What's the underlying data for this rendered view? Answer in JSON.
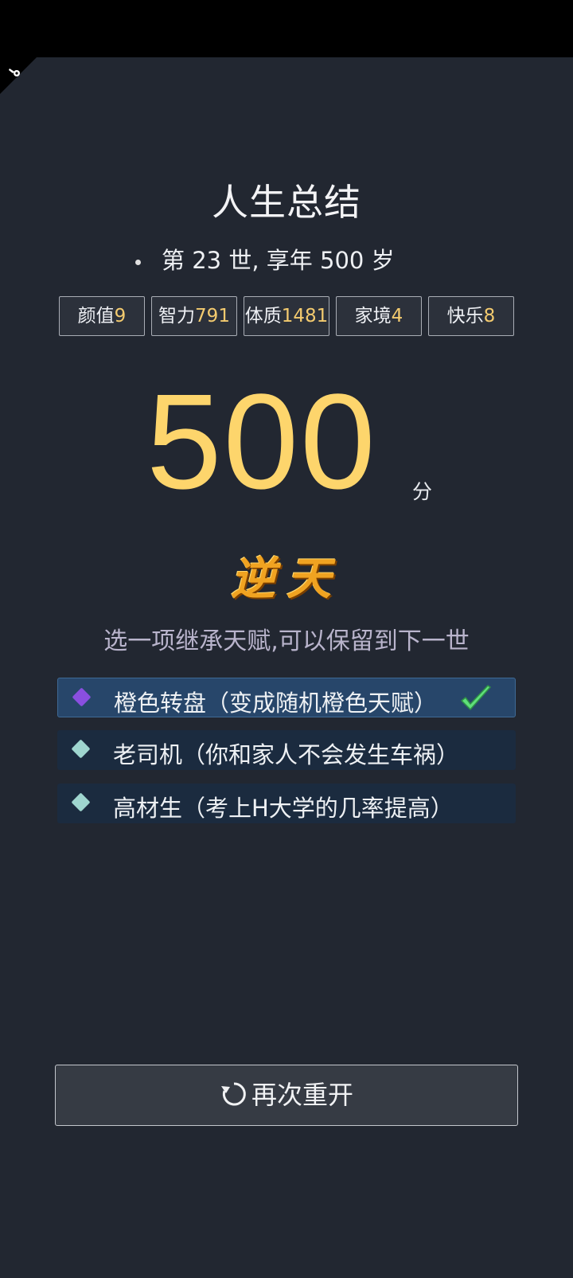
{
  "summary": {
    "title": "人生总结",
    "age_line": "第 23 世, 享年 500 岁"
  },
  "stats": [
    {
      "label": "颜值",
      "value": "9"
    },
    {
      "label": "智力",
      "value": "791"
    },
    {
      "label": "体质",
      "value": "1481"
    },
    {
      "label": "家境",
      "value": "4"
    },
    {
      "label": "快乐",
      "value": "8"
    }
  ],
  "score": {
    "value": "500",
    "unit": "分",
    "rank": "逆天"
  },
  "inherit": {
    "prompt": "选一项继承天赋,可以保留到下一世",
    "talents": [
      {
        "label": "橙色转盘（变成随机橙色天赋）",
        "color": "#8a4fe0",
        "selected": true
      },
      {
        "label": "老司机（你和家人不会发生车祸）",
        "color": "#9fd6cf",
        "selected": false
      },
      {
        "label": "高材生（考上H大学的几率提高）",
        "color": "#9fd6cf",
        "selected": false
      }
    ]
  },
  "restart": {
    "label": "再次重开",
    "icon": "refresh-icon"
  },
  "colors": {
    "background": "#222731",
    "accent_gold": "#fdd56c",
    "check_green": "#5fe07a"
  }
}
